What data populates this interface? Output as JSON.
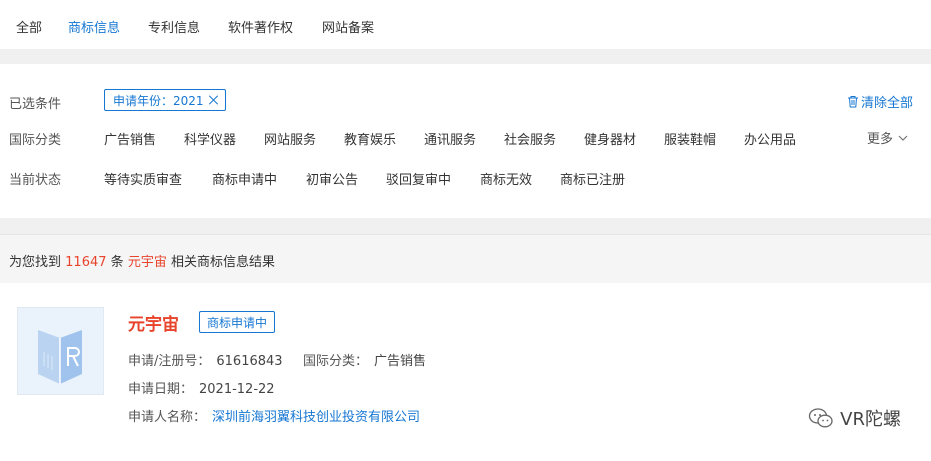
{
  "tabs": [
    {
      "label": "全部",
      "active": false
    },
    {
      "label": "商标信息",
      "active": true
    },
    {
      "label": "专利信息",
      "active": false
    },
    {
      "label": "软件著作权",
      "active": false
    },
    {
      "label": "网站备案",
      "active": false
    }
  ],
  "filters": {
    "selected_label": "已选条件",
    "selected_chip": "申请年份：2021",
    "clear_all": "清除全部",
    "intl_class_label": "国际分类",
    "intl_classes": [
      "广告销售",
      "科学仪器",
      "网站服务",
      "教育娱乐",
      "通讯服务",
      "社会服务",
      "健身器材",
      "服装鞋帽",
      "办公用品"
    ],
    "more": "更多",
    "status_label": "当前状态",
    "statuses": [
      "等待实质审查",
      "商标申请中",
      "初审公告",
      "驳回复审中",
      "商标无效",
      "商标已注册"
    ]
  },
  "result": {
    "prefix": "为您找到",
    "count": "11647",
    "unit": "条",
    "keyword": "元宇宙",
    "suffix": "相关商标信息结果"
  },
  "card": {
    "title": "元宇宙",
    "status": "商标申请中",
    "reg_no_label": "申请/注册号：",
    "reg_no": "61616843",
    "class_label": "国际分类：",
    "class_value": "广告销售",
    "date_label": "申请日期：",
    "date": "2021-12-22",
    "applicant_label": "申请人名称：",
    "applicant": "深圳前海羽翼科技创业投资有限公司"
  },
  "watermark": "VR陀螺",
  "colors": {
    "accent": "#1677d2",
    "highlight": "#e8432b"
  }
}
